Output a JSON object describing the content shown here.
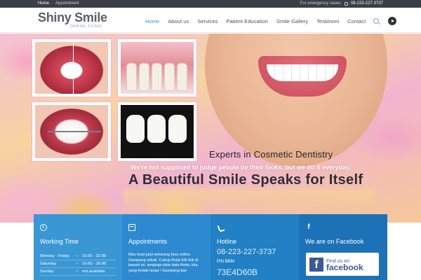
{
  "topbar": {
    "links": [
      "Home",
      "Appointment"
    ],
    "emergency_label": "For emergency cases:",
    "emergency_phone": "08-223-227-3737"
  },
  "logo": {
    "name": "Shiny Smile",
    "tagline": "DENTAL CLINIC"
  },
  "nav": {
    "items": [
      "Home",
      "About us",
      "Services",
      "Patient Education",
      "Smile Gallery",
      "Testimoni",
      "Contact"
    ],
    "active_index": 0,
    "icons": [
      "search-icon",
      "play-icon"
    ]
  },
  "hero": {
    "experts": "Experts in Cosmetic Dentistry",
    "subline": "We're not supposed to judge people by their looks, but we do it everyday.",
    "headline": "A Beautiful Smile Speaks for Itself"
  },
  "boxes": {
    "working": {
      "title": "Working Time",
      "rows": [
        {
          "day": "Monday - Friday",
          "sep": "–",
          "time": "10.00 - 22.00"
        },
        {
          "day": "Saturday",
          "sep": "–",
          "time": "10.00 - 16.00"
        },
        {
          "day": "Sunday",
          "sep": "–",
          "time": "not available"
        }
      ]
    },
    "appointments": {
      "title": "Appointments",
      "text": "Mau buat janji sekarang bisa online. Gampang sekali. Cukup Anda klik link di bawah ini, lengkapi data data Anda, kita yang tindak lanjut ! Gampang kan"
    },
    "hotline": {
      "title": "Hotline",
      "phone": "08-223-227-3737",
      "pin_label": "PIN BBM:",
      "pin": "73E4D60B"
    },
    "facebook": {
      "title": "We are on Facebook",
      "button_find": "Find us on:",
      "button_brand": "facebook",
      "button_letter": "f"
    }
  },
  "colors": {
    "topbar": "#3a3f47",
    "nav_active": "#3f8fc9",
    "box1": "#3a97d4",
    "box2": "#2e8ad0",
    "box3": "#2280c4",
    "box4": "#1d72b7",
    "facebook": "#3b5998"
  }
}
